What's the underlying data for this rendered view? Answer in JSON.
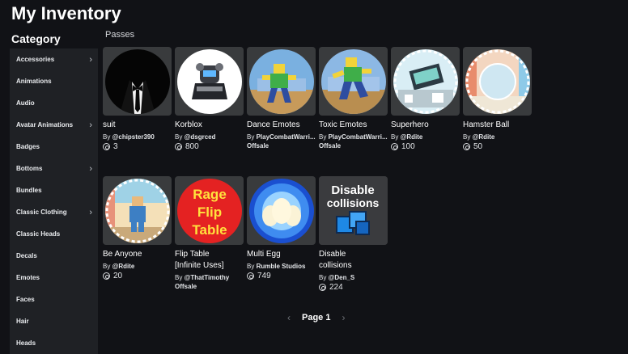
{
  "header": {
    "title": "My Inventory"
  },
  "sidebar": {
    "title": "Category",
    "items": [
      {
        "label": "Accessories",
        "chevron": true
      },
      {
        "label": "Animations",
        "chevron": false
      },
      {
        "label": "Audio",
        "chevron": false
      },
      {
        "label": "Avatar Animations",
        "chevron": true
      },
      {
        "label": "Badges",
        "chevron": false
      },
      {
        "label": "Bottoms",
        "chevron": true
      },
      {
        "label": "Bundles",
        "chevron": false
      },
      {
        "label": "Classic Clothing",
        "chevron": true
      },
      {
        "label": "Classic Heads",
        "chevron": false
      },
      {
        "label": "Decals",
        "chevron": false
      },
      {
        "label": "Emotes",
        "chevron": false
      },
      {
        "label": "Faces",
        "chevron": false
      },
      {
        "label": "Hair",
        "chevron": false
      },
      {
        "label": "Heads",
        "chevron": false
      }
    ]
  },
  "main": {
    "section_label": "Passes",
    "items": [
      {
        "name": "suit",
        "creator_prefix": "By ",
        "creator": "@chipster390",
        "price": "3",
        "offsale": "",
        "icon": "tuxedo-thumb"
      },
      {
        "name": "Korblox",
        "creator_prefix": "By ",
        "creator": "@dsgrced",
        "price": "800",
        "offsale": "",
        "icon": "korblox-thumb"
      },
      {
        "name": "Dance Emotes",
        "creator_prefix": "By ",
        "creator": "PlayCombatWarri...",
        "price": "",
        "offsale": "Offsale",
        "icon": "dance-thumb"
      },
      {
        "name": "Toxic Emotes",
        "creator_prefix": "By ",
        "creator": "PlayCombatWarri...",
        "price": "",
        "offsale": "Offsale",
        "icon": "toxic-thumb"
      },
      {
        "name": "Superhero",
        "creator_prefix": "By ",
        "creator": "@Rdite",
        "price": "100",
        "offsale": "",
        "icon": "superhero-thumb"
      },
      {
        "name": "Hamster Ball",
        "creator_prefix": "By ",
        "creator": "@Rdite",
        "price": "50",
        "offsale": "",
        "icon": "hamster-thumb"
      },
      {
        "name": "Be Anyone",
        "creator_prefix": "By ",
        "creator": "@Rdite",
        "price": "20",
        "offsale": "",
        "icon": "be-anyone-thumb"
      },
      {
        "name": "Flip Table",
        "name2": "[Infinite Uses]",
        "creator_prefix": "By ",
        "creator": "@ThatTimothy",
        "price": "",
        "offsale": "Offsale",
        "icon": "flip-table-thumb",
        "thumb_text": [
          "Rage",
          "Flip",
          "Table"
        ]
      },
      {
        "name": "Multi Egg",
        "creator_prefix": "By ",
        "creator": "Rumble Studios",
        "price": "749",
        "offsale": "",
        "icon": "egg-thumb"
      },
      {
        "name": "Disable",
        "name2": "collisions",
        "creator_prefix": "By ",
        "creator": "@Den_S",
        "price": "224",
        "offsale": "",
        "icon": "collisions-thumb",
        "thumb_text": [
          "Disable",
          "collisions"
        ]
      }
    ]
  },
  "pager": {
    "prev": "‹",
    "label": "Page 1",
    "next": "›"
  }
}
